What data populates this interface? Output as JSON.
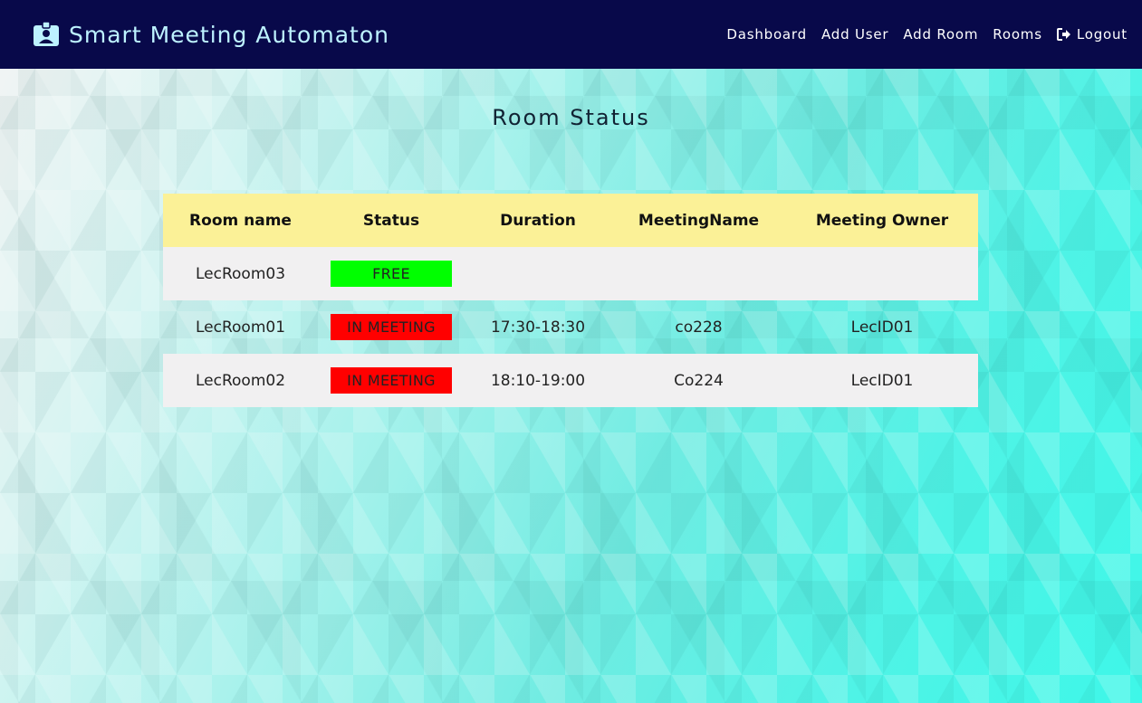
{
  "navbar": {
    "brand": "Smart Meeting Automaton",
    "brand_icon": "id-badge-icon",
    "links": [
      "Dashboard",
      "Add User",
      "Add Room",
      "Rooms"
    ],
    "logout_label": "Logout",
    "logout_icon": "sign-out-icon"
  },
  "page": {
    "title": "Room Status"
  },
  "table": {
    "headers": [
      "Room name",
      "Status",
      "Duration",
      "MeetingName",
      "Meeting Owner"
    ],
    "rows": [
      {
        "room": "LecRoom03",
        "status": "FREE",
        "status_color": "#00ff00",
        "duration": "",
        "meeting": "",
        "owner": ""
      },
      {
        "room": "LecRoom01",
        "status": "IN MEETING",
        "status_color": "#ff0000",
        "duration": "17:30-18:30",
        "meeting": "co228",
        "owner": "LecID01"
      },
      {
        "room": "LecRoom02",
        "status": "IN MEETING",
        "status_color": "#ff0000",
        "duration": "18:10-19:00",
        "meeting": "Co224",
        "owner": "LecID01"
      }
    ]
  },
  "colors": {
    "navbar_bg": "#08094a",
    "header_bg": "#fbf197",
    "free": "#00ff00",
    "in_meeting": "#ff0000"
  }
}
